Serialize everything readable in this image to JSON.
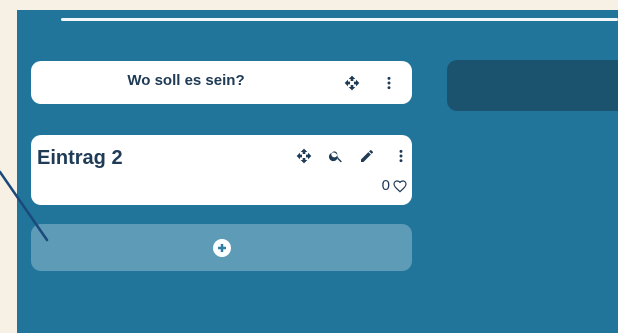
{
  "board": {
    "columns": [
      {
        "title": "Wo soll es sein?",
        "tools": [
          "move-icon",
          "more-vert-icon"
        ]
      }
    ],
    "entries": [
      {
        "title": "Eintrag 2",
        "like_count": "0",
        "tools": [
          "move-icon",
          "search-icon",
          "edit-icon",
          "more-vert-icon"
        ]
      }
    ],
    "add_button_icon": "add-circle-icon"
  },
  "colors": {
    "page": "#f6f1e4",
    "board": "#21759b",
    "text": "#203b56",
    "empty_column": "#1b536e"
  }
}
